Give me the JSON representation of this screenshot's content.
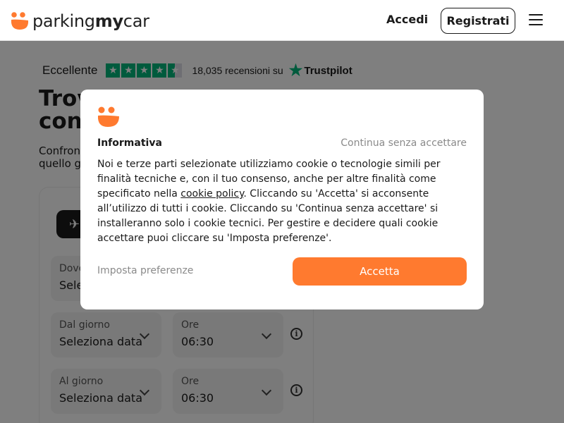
{
  "header": {
    "logo_regular": "parking",
    "logo_bold": "my",
    "logo_regular2": "car",
    "login_label": "Accedi",
    "register_label": "Registrati"
  },
  "trust": {
    "rating_label": "Eccellente",
    "stars": 4.5,
    "review_count": "18,035 recensioni su",
    "provider": "Trustpilot"
  },
  "hero": {
    "title_line1": "Trov",
    "title_line2": "con",
    "subtitle_line1": "Confron",
    "subtitle_line2": "quello g"
  },
  "form": {
    "where_label": "Dove",
    "where_value": "Sele",
    "from_day_label": "Dal giorno",
    "from_day_value": "Seleziona data",
    "from_time_label": "Ore",
    "from_time_value": "06:30",
    "to_day_label": "Al giorno",
    "to_day_value": "Seleziona data",
    "to_time_label": "Ore",
    "to_time_value": "06:30"
  },
  "modal": {
    "title": "Informativa",
    "skip_label": "Continua senza accettare",
    "text_before_link": "Noi e terze parti selezionate utilizziamo cookie o tecnologie simili per finalità tecniche e, con il tuo consenso, anche per altre finalità come specificato nella ",
    "link_label": "cookie policy",
    "text_after_link": ". Cliccando su 'Accetta' si acconsente all’utilizzo di tutti i cookie. Cliccando su 'Continua senza accettare' si installeranno solo i cookie tecnici. Per gestire e decidere quali cookie accettare puoi cliccare su 'Imposta preferenze'.",
    "prefs_label": "Imposta preferenze",
    "accept_label": "Accetta"
  },
  "colors": {
    "brand_orange": "#ff7a2f",
    "trustpilot_green": "#00b67a",
    "overlay": "rgba(0,0,0,0.5)"
  }
}
